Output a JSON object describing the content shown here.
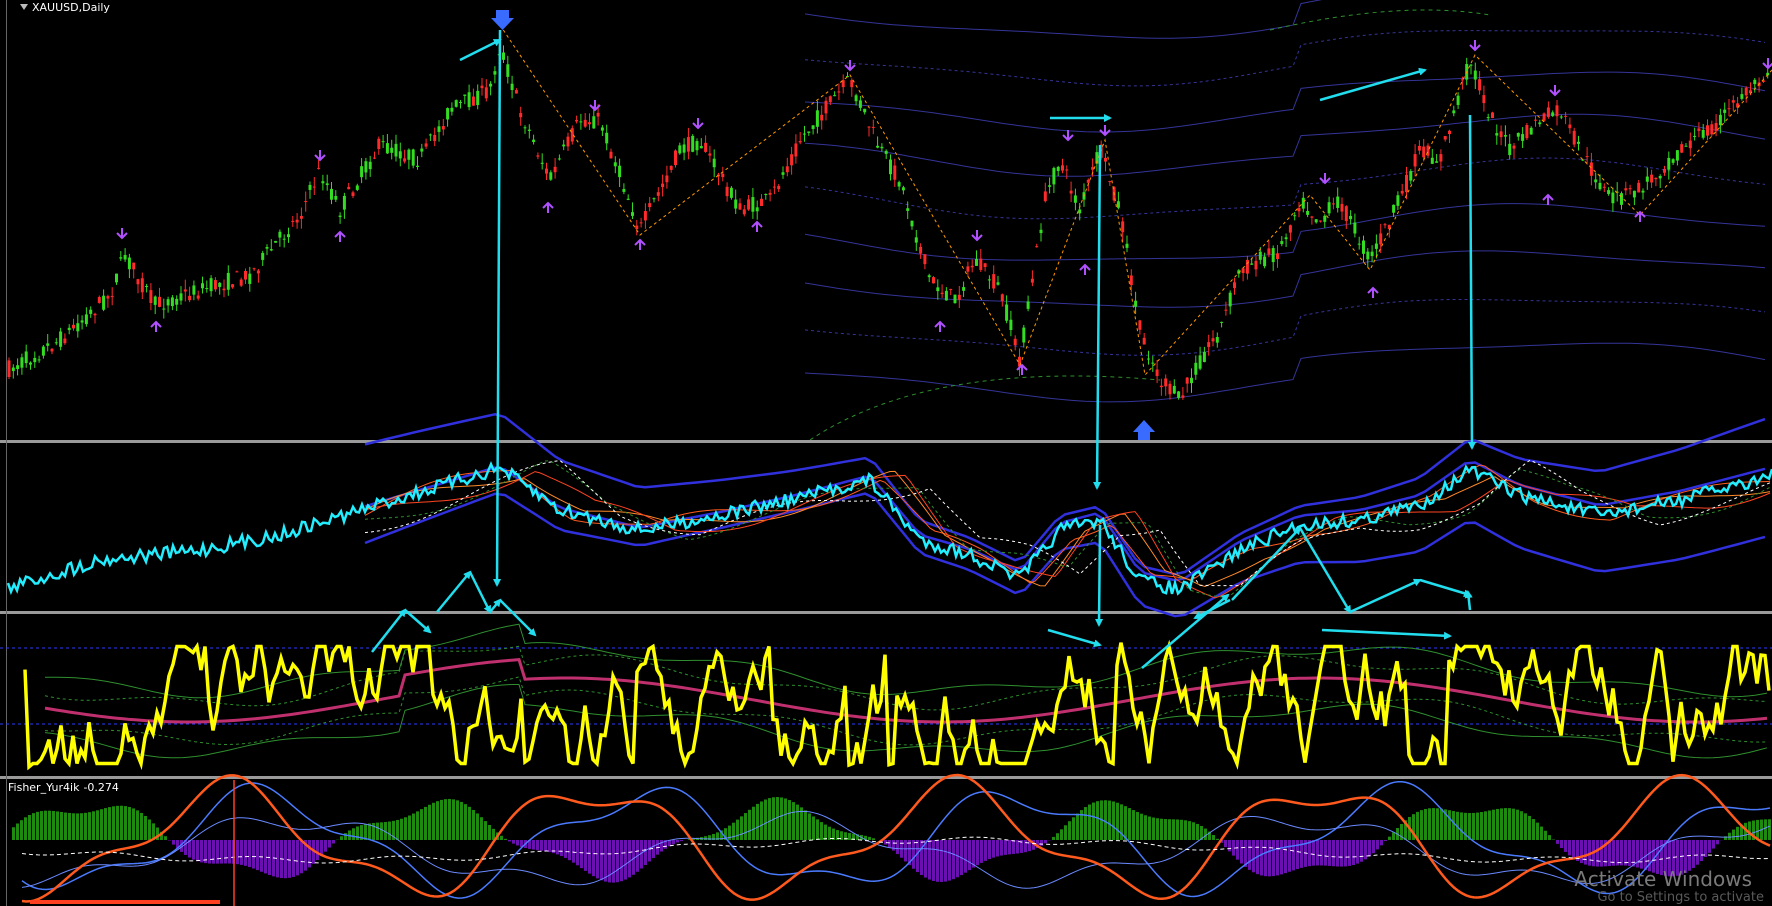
{
  "window": {
    "symbol_title": "XAUUSD,Daily"
  },
  "indicator_fisher": {
    "name": "Fisher_Yur4ik",
    "value": "-0.274"
  },
  "watermark": {
    "title": "Activate Windows",
    "subtitle": "Go to Settings to activate"
  },
  "colors": {
    "background": "#000000",
    "bull_candle": "#33dd22",
    "bear_candle": "#ff2a2a",
    "zigzag": "#ff9900",
    "arrow_annotation": "#22ddee",
    "fractal_marker": "#b050ff",
    "envelope_band": "#3a3aa8",
    "oscillator_yellow": "#ffff00",
    "signal_pink": "#c0306e",
    "histogram_up": "#1f8a10",
    "histogram_down": "#6a0fb0",
    "fisher_orange": "#ff5a1e",
    "fisher_blue": "#4a7bff",
    "pane_separator": "#aaaaaa"
  },
  "icons": [
    "fractal-up-icon",
    "fractal-down-icon",
    "big-arrow-down-icon",
    "big-arrow-up-icon",
    "dropdown-triangle-icon"
  ]
}
